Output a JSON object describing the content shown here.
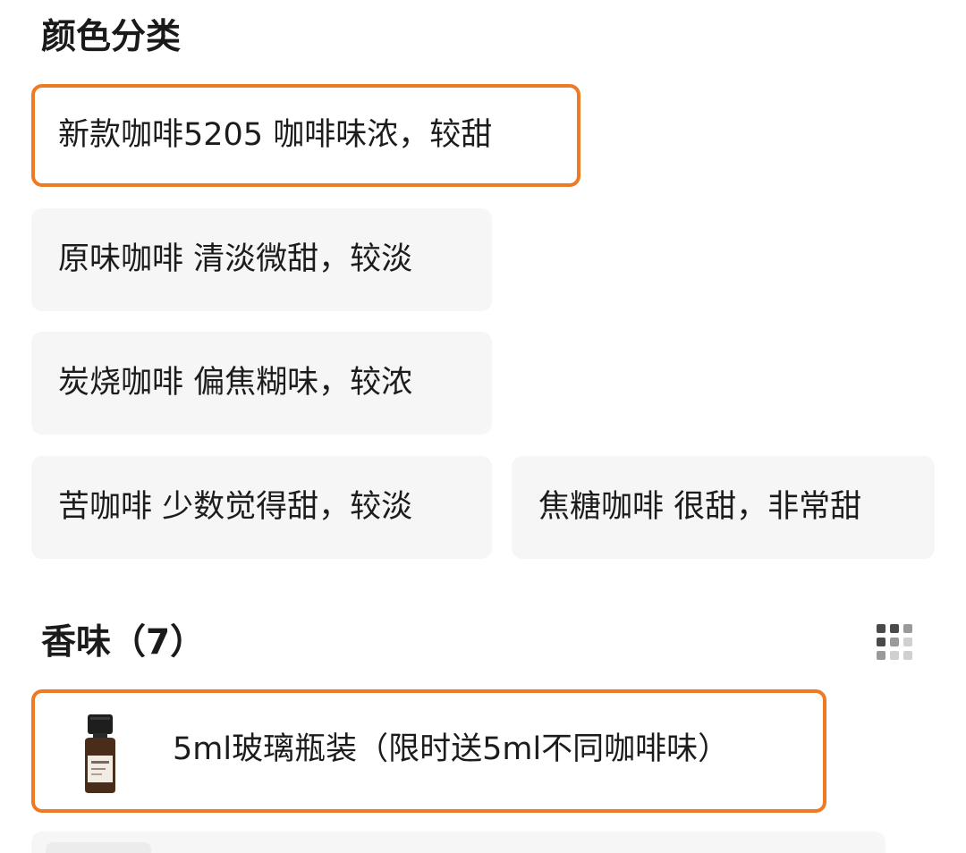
{
  "color_section": {
    "title": "颜色分类",
    "options": [
      {
        "label": "新款咖啡5205 咖啡味浓，较甜",
        "selected": true
      },
      {
        "label": "原味咖啡 清淡微甜，较淡",
        "selected": false
      },
      {
        "label": "炭烧咖啡 偏焦糊味，较浓",
        "selected": false
      },
      {
        "label": "苦咖啡 少数觉得甜，较淡",
        "selected": false
      },
      {
        "label": "焦糖咖啡 很甜，非常甜",
        "selected": false
      }
    ]
  },
  "scent_section": {
    "title": "香味（7）",
    "layout_toggle_icon": "grid-icon",
    "options": [
      {
        "label": "5ml玻璃瓶装（限时送5ml不同咖啡味）",
        "selected": true,
        "thumbnail_icon": "bottle-icon"
      }
    ]
  },
  "colors": {
    "accent": "#ef7a26",
    "option_background": "#f6f6f6"
  }
}
